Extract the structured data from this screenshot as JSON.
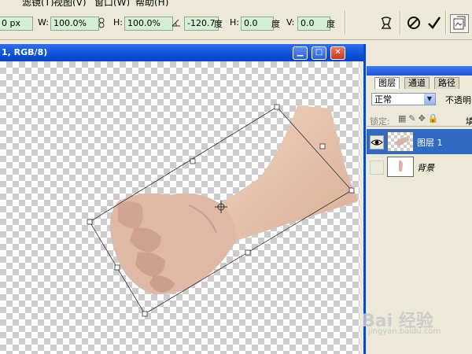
{
  "menubar": {
    "items": [
      "滤镜(T)",
      "视图(V)",
      "窗口(W)",
      "帮助(H)"
    ]
  },
  "options": {
    "x_value": "0 px",
    "w_label": "W:",
    "w_value": "100.0%",
    "h_label": "H:",
    "h_value": "100.0%",
    "angle_value": "-120.7",
    "angle_unit": "度",
    "hskew_label": "H:",
    "hskew_value": "0.0",
    "hskew_unit": "度",
    "vskew_label": "V:",
    "vskew_value": "0.0",
    "vskew_unit": "度"
  },
  "document": {
    "title": "1, RGB/8)"
  },
  "layers_panel": {
    "tabs": [
      "图层",
      "通道",
      "路径"
    ],
    "blend_mode": "正常",
    "opacity_label": "不透明",
    "lock_label": "锁定:",
    "fill_label": "填",
    "layers": [
      {
        "name": "图层 1",
        "selected": true,
        "visible": true
      },
      {
        "name": "背景",
        "selected": false,
        "visible": false
      }
    ]
  },
  "watermark": {
    "text": "Bai 经验",
    "url": "jingyan.baidu.com"
  },
  "colors": {
    "titlebar": "#0b52d8",
    "selection": "#316ac5",
    "field_bg": "#d4f0d4"
  }
}
